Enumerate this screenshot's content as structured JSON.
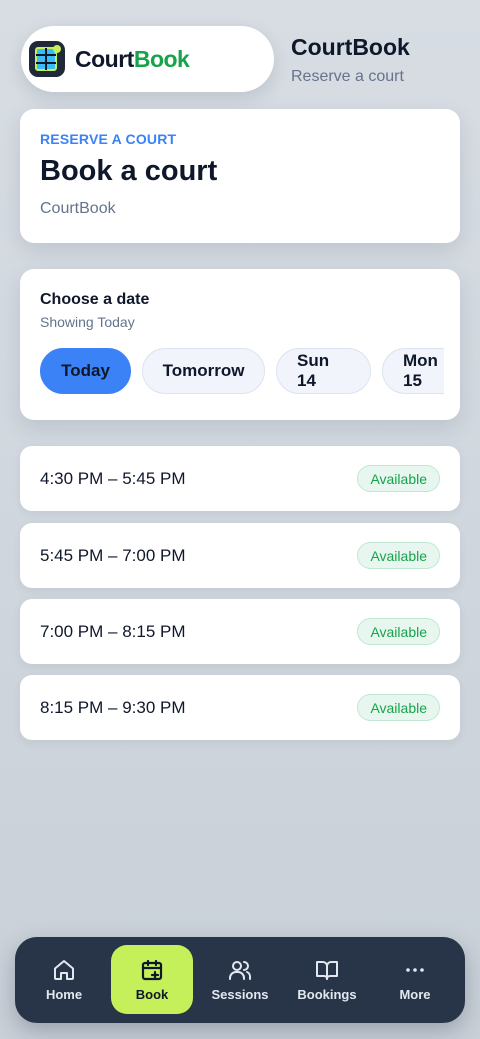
{
  "header": {
    "logo_part1": "Court",
    "logo_part2": "Book",
    "title": "CourtBook",
    "subtitle": "Reserve a court"
  },
  "hero": {
    "eyebrow": "RESERVE A COURT",
    "title": "Book a court",
    "subtitle": "CourtBook"
  },
  "date_picker": {
    "title": "Choose a date",
    "subtitle": "Showing Today",
    "chips": [
      {
        "label": "Today",
        "selected": true
      },
      {
        "label": "Tomorrow",
        "selected": false
      },
      {
        "label": "Sun 14",
        "selected": false
      },
      {
        "label": "Mon 15",
        "selected": false
      }
    ]
  },
  "slots": [
    {
      "time": "4:30 PM – 5:45 PM",
      "status": "Available"
    },
    {
      "time": "5:45 PM – 7:00 PM",
      "status": "Available"
    },
    {
      "time": "7:00 PM – 8:15 PM",
      "status": "Available"
    },
    {
      "time": "8:15 PM – 9:30 PM",
      "status": "Available"
    }
  ],
  "nav": {
    "items": [
      {
        "label": "Home",
        "icon": "home-icon"
      },
      {
        "label": "Book",
        "icon": "calendar-plus-icon",
        "active": true
      },
      {
        "label": "Sessions",
        "icon": "users-icon"
      },
      {
        "label": "Bookings",
        "icon": "book-open-icon"
      },
      {
        "label": "More",
        "icon": "more-dots-icon"
      }
    ]
  },
  "colors": {
    "accent": "#3b82f6",
    "brand_green": "#16a34a",
    "nav_bg": "#283447",
    "nav_active": "#c6f05a"
  }
}
